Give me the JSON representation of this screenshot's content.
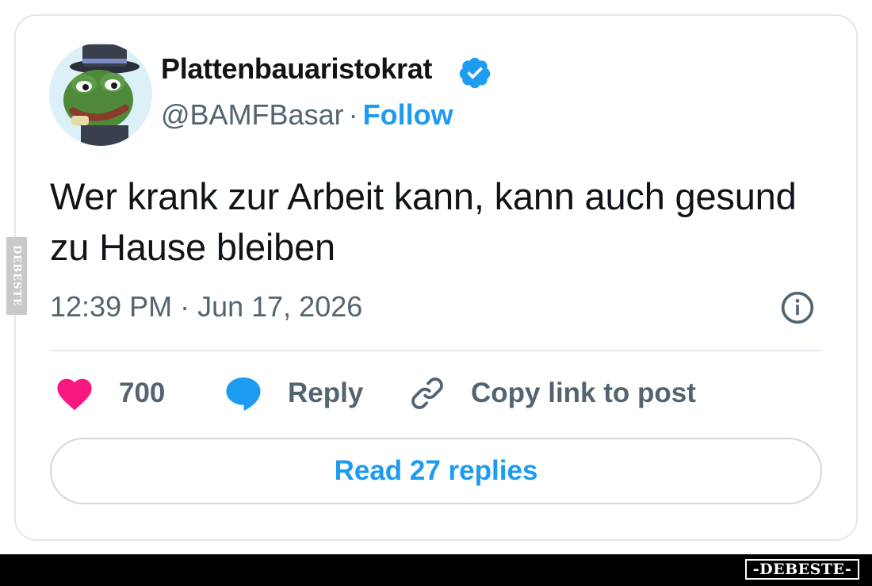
{
  "tweet": {
    "author": {
      "display_name": "Plattenbauaristokrat",
      "handle": "@BAMFBasar",
      "separator": "·",
      "follow_label": "Follow",
      "verified": true
    },
    "text": "Wer krank zur Arbeit kann, kann auch gesund zu Hause bleiben",
    "timestamp": "12:39 PM · Jun 17, 2026",
    "actions": {
      "like_count": "700",
      "reply_label": "Reply",
      "copy_link_label": "Copy link to post"
    },
    "read_replies_label": "Read 27 replies"
  },
  "icons": {
    "verified": "verified-badge-icon",
    "info": "info-icon",
    "like": "heart-icon",
    "reply": "speech-bubble-icon",
    "copy": "link-icon"
  },
  "colors": {
    "accent": "#1d9bf0",
    "like": "#f91880",
    "text": "#0f1419",
    "secondary": "#536471",
    "border": "#e1e8ed"
  },
  "watermark": {
    "side_text": "DEBESTE",
    "footer_logo": "-DEBESTE-"
  }
}
